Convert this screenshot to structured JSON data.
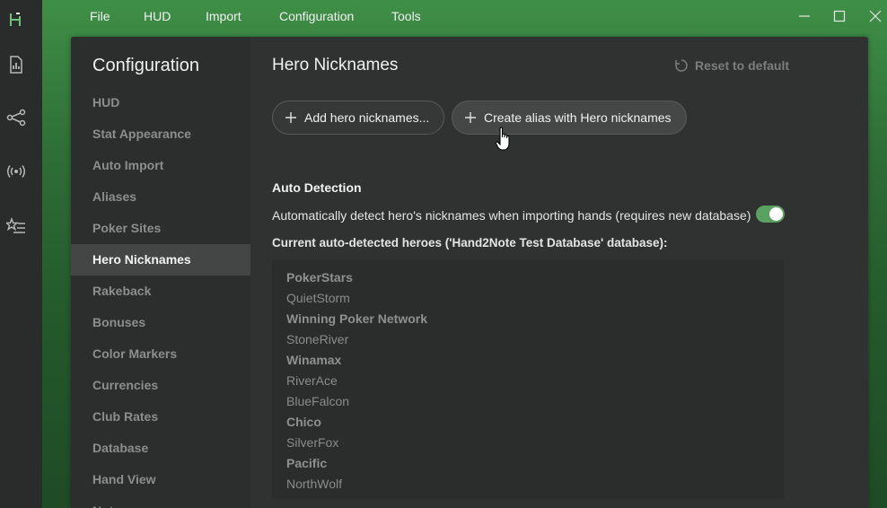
{
  "app": {
    "logo": "H",
    "colors": {
      "accent": "#3f8f47",
      "toggle_on": "#5aa060"
    }
  },
  "rail": {
    "icons": [
      "logo-icon",
      "report-icon",
      "share-graph-icon",
      "broadcast-icon",
      "star-list-icon"
    ]
  },
  "menu": {
    "items": [
      "File",
      "HUD",
      "Import",
      "Configuration",
      "Tools"
    ]
  },
  "window_controls": [
    "minimize-icon",
    "maximize-icon",
    "close-icon"
  ],
  "nav": {
    "title": "Configuration",
    "items": [
      "HUD",
      "Stat Appearance",
      "Auto Import",
      "Aliases",
      "Poker Sites",
      "Hero Nicknames",
      "Rakeback",
      "Bonuses",
      "Color Markers",
      "Currencies",
      "Club Rates",
      "Database",
      "Hand View",
      "Notes"
    ],
    "active_index": 5
  },
  "content": {
    "title": "Hero Nicknames",
    "reset_label": "Reset to default",
    "add_button": "Add hero nicknames...",
    "alias_button": "Create alias with Hero nicknames",
    "auto_detection": {
      "heading": "Auto Detection",
      "description": "Automatically detect hero's nicknames when importing hands (requires new database)",
      "enabled": true,
      "current_label": "Current auto-detected heroes ('Hand2Note Test Database' database):"
    },
    "heroes": [
      {
        "text": "PokerStars",
        "type": "site"
      },
      {
        "text": "QuietStorm",
        "type": "nick"
      },
      {
        "text": "Winning Poker Network",
        "type": "site"
      },
      {
        "text": "StoneRiver",
        "type": "nick"
      },
      {
        "text": "Winamax",
        "type": "site"
      },
      {
        "text": "RiverAce",
        "type": "nick"
      },
      {
        "text": "BlueFalcon",
        "type": "nick"
      },
      {
        "text": "Chico",
        "type": "site"
      },
      {
        "text": "SilverFox",
        "type": "nick"
      },
      {
        "text": "Pacific",
        "type": "site"
      },
      {
        "text": "NorthWolf",
        "type": "nick"
      }
    ]
  }
}
